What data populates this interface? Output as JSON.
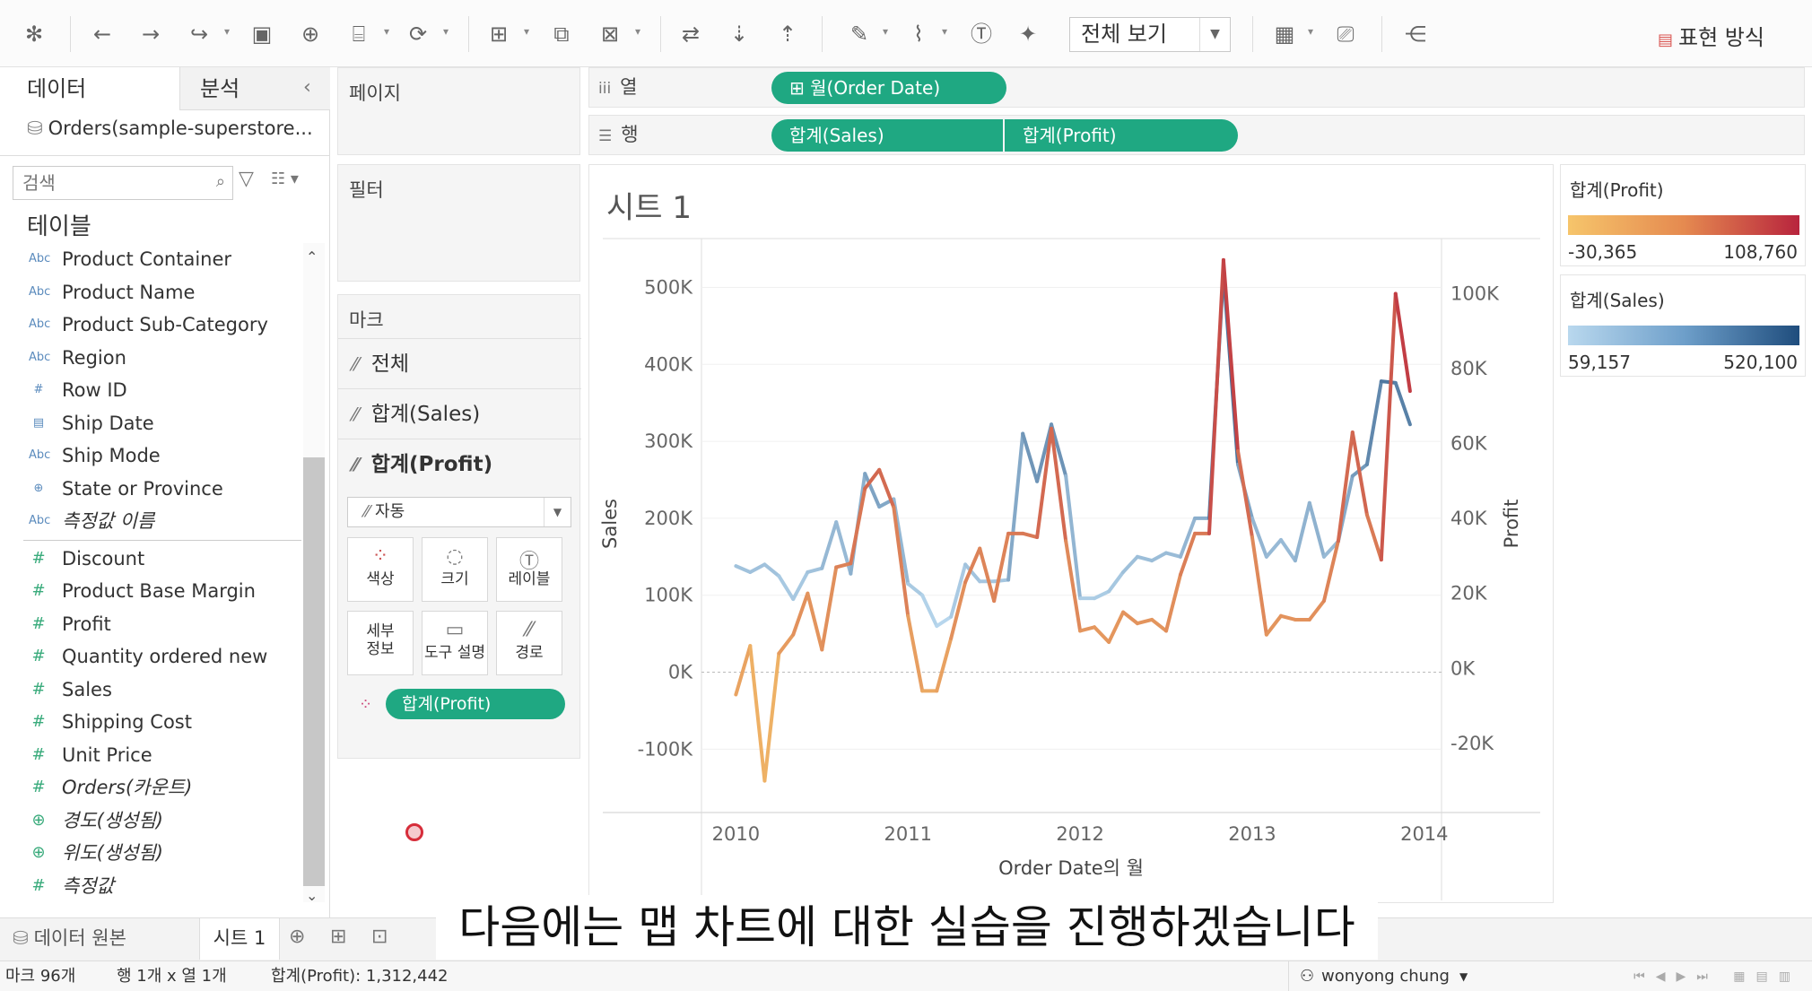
{
  "toolbar": {
    "fit": "전체 보기",
    "show_me": "표현 방식"
  },
  "data_pane": {
    "tab_data": "데이터",
    "tab_analysis": "분석",
    "datasource": "Orders(sample-superstore...",
    "search_placeholder": "검색",
    "tables_heading": "테이블",
    "dimensions": [
      {
        "type": "Abc",
        "label": "Product Container",
        "italic": false
      },
      {
        "type": "Abc",
        "label": "Product Name",
        "italic": false
      },
      {
        "type": "Abc",
        "label": "Product Sub-Category",
        "italic": false
      },
      {
        "type": "Abc",
        "label": "Region",
        "italic": false
      },
      {
        "type": "#",
        "label": "Row ID",
        "italic": false
      },
      {
        "type": "date",
        "label": "Ship Date",
        "italic": false
      },
      {
        "type": "Abc",
        "label": "Ship Mode",
        "italic": false
      },
      {
        "type": "geo",
        "label": "State or Province",
        "italic": false
      },
      {
        "type": "Abc",
        "label": "측정값 이름",
        "italic": true
      }
    ],
    "measures": [
      {
        "type": "#",
        "label": "Discount",
        "italic": false
      },
      {
        "type": "#",
        "label": "Product Base Margin",
        "italic": false
      },
      {
        "type": "#",
        "label": "Profit",
        "italic": false
      },
      {
        "type": "#",
        "label": "Quantity ordered new",
        "italic": false
      },
      {
        "type": "#",
        "label": "Sales",
        "italic": false
      },
      {
        "type": "#",
        "label": "Shipping Cost",
        "italic": false
      },
      {
        "type": "#",
        "label": "Unit Price",
        "italic": false
      },
      {
        "type": "#",
        "label": "Orders(카운트)",
        "italic": true
      },
      {
        "type": "geo",
        "label": "경도(생성됨)",
        "italic": true
      },
      {
        "type": "geo",
        "label": "위도(생성됨)",
        "italic": true
      },
      {
        "type": "#",
        "label": "측정값",
        "italic": true
      }
    ]
  },
  "cards": {
    "pages": "페이지",
    "filters": "필터",
    "marks": "마크",
    "mark_rows": [
      "전체",
      "합계(Sales)",
      "합계(Profit)"
    ],
    "mark_type": "자동",
    "buttons": {
      "color": "색상",
      "size": "크기",
      "label": "레이블",
      "detail_1": "세부",
      "detail_2": "정보",
      "tooltip": "도구 설명",
      "path": "경로"
    },
    "color_pill": "합계(Profit)"
  },
  "shelves": {
    "columns_label": "열",
    "rows_label": "행",
    "columns_pill": "⊞ 월(Order Date)",
    "rows_pills": [
      "합계(Sales)",
      "합계(Profit)"
    ]
  },
  "sheet": {
    "title": "시트 1"
  },
  "legends": {
    "profit": {
      "title": "합계(Profit)",
      "min": "-30,365",
      "max": "108,760"
    },
    "sales": {
      "title": "합계(Sales)",
      "min": "59,157",
      "max": "520,100"
    }
  },
  "chart_data": {
    "type": "line",
    "xlabel": "Order Date의 월",
    "ylabel_left": "Sales",
    "ylabel_right": "Profit",
    "x_ticks": [
      "2010",
      "2011",
      "2012",
      "2013",
      "2014"
    ],
    "y_left_ticks": [
      "-100K",
      "0K",
      "100K",
      "200K",
      "300K",
      "400K",
      "500K"
    ],
    "y_right_ticks": [
      "-20K",
      "0K",
      "20K",
      "40K",
      "60K",
      "80K",
      "100K"
    ],
    "ylim_left": [
      -180000,
      560000
    ],
    "ylim_right": [
      -38000,
      114000
    ],
    "x_range": [
      2009.8,
      2014.1
    ],
    "series": [
      {
        "name": "합계(Sales)",
        "color_min": "#b9d8ee",
        "color_max": "#1f4d7d",
        "x": [
          2010.0,
          2010.083,
          2010.167,
          2010.25,
          2010.333,
          2010.417,
          2010.5,
          2010.583,
          2010.667,
          2010.75,
          2010.833,
          2010.917,
          2011.0,
          2011.083,
          2011.167,
          2011.25,
          2011.333,
          2011.417,
          2011.5,
          2011.583,
          2011.667,
          2011.75,
          2011.833,
          2011.917,
          2012.0,
          2012.083,
          2012.167,
          2012.25,
          2012.333,
          2012.417,
          2012.5,
          2012.583,
          2012.667,
          2012.75,
          2012.833,
          2012.917,
          2013.0,
          2013.083,
          2013.167,
          2013.25,
          2013.333,
          2013.417,
          2013.5,
          2013.583,
          2013.667,
          2013.75,
          2013.833,
          2013.917
        ],
        "values": [
          138000,
          130000,
          140000,
          125000,
          95000,
          130000,
          135000,
          195000,
          128000,
          258000,
          215000,
          225000,
          115000,
          100000,
          60000,
          72000,
          140000,
          118000,
          118000,
          120000,
          310000,
          248000,
          322000,
          255000,
          96000,
          96000,
          105000,
          130000,
          150000,
          145000,
          155000,
          150000,
          200000,
          200000,
          520000,
          270000,
          200000,
          150000,
          172000,
          145000,
          220000,
          150000,
          170000,
          255000,
          270000,
          378000,
          376000,
          322000
        ]
      },
      {
        "name": "합계(Profit)",
        "color_min": "#f6c56b",
        "color_max": "#b8243d",
        "x": [
          2010.0,
          2010.083,
          2010.167,
          2010.25,
          2010.333,
          2010.417,
          2010.5,
          2010.583,
          2010.667,
          2010.75,
          2010.833,
          2010.917,
          2011.0,
          2011.083,
          2011.167,
          2011.25,
          2011.333,
          2011.417,
          2011.5,
          2011.583,
          2011.667,
          2011.75,
          2011.833,
          2011.917,
          2012.0,
          2012.083,
          2012.167,
          2012.25,
          2012.333,
          2012.417,
          2012.5,
          2012.583,
          2012.667,
          2012.75,
          2012.833,
          2012.917,
          2013.0,
          2013.083,
          2013.167,
          2013.25,
          2013.333,
          2013.417,
          2013.5,
          2013.583,
          2013.667,
          2013.75,
          2013.833,
          2013.917
        ],
        "values": [
          -7000,
          6000,
          -30000,
          4000,
          9000,
          20000,
          5000,
          27000,
          28000,
          48000,
          53000,
          43000,
          14000,
          -6000,
          -6000,
          8000,
          23000,
          32000,
          18000,
          36000,
          36000,
          35000,
          64000,
          34000,
          10000,
          11000,
          7000,
          15000,
          12000,
          13000,
          10000,
          25000,
          36000,
          36000,
          109000,
          58000,
          35000,
          9000,
          14000,
          13000,
          13000,
          18000,
          34000,
          63000,
          41000,
          29000,
          100000,
          74000
        ]
      }
    ]
  },
  "tabs": {
    "data_source": "데이터 원본",
    "sheet1": "시트 1"
  },
  "subtitle": "다음에는 맵 차트에 대한 실습을 진행하겠습니다",
  "status": {
    "marks": "마크 96개",
    "rows_cols": "행 1개 x 열 1개",
    "sum_profit": "합계(Profit): 1,312,442",
    "user": "wonyong chung"
  }
}
